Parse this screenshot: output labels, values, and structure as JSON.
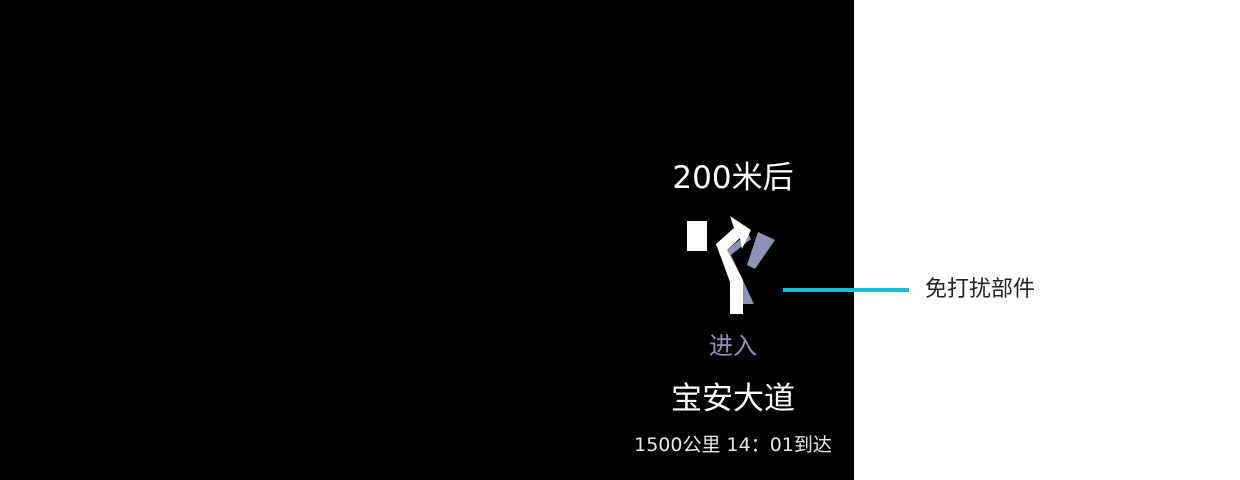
{
  "navigation": {
    "distance_label": "200米后",
    "turn_icon": "fork-left-icon",
    "action_label": "进入",
    "road_name": "宝安大道",
    "eta_label": "1500公里 14：01到达"
  },
  "annotation": {
    "label": "免打扰部件"
  },
  "colors": {
    "screen_background": "#000000",
    "primary_text": "#ffffff",
    "action_text": "#8d93b7",
    "secondary_arrow": "#8d93b7",
    "callout_line": "#21b8d4"
  }
}
